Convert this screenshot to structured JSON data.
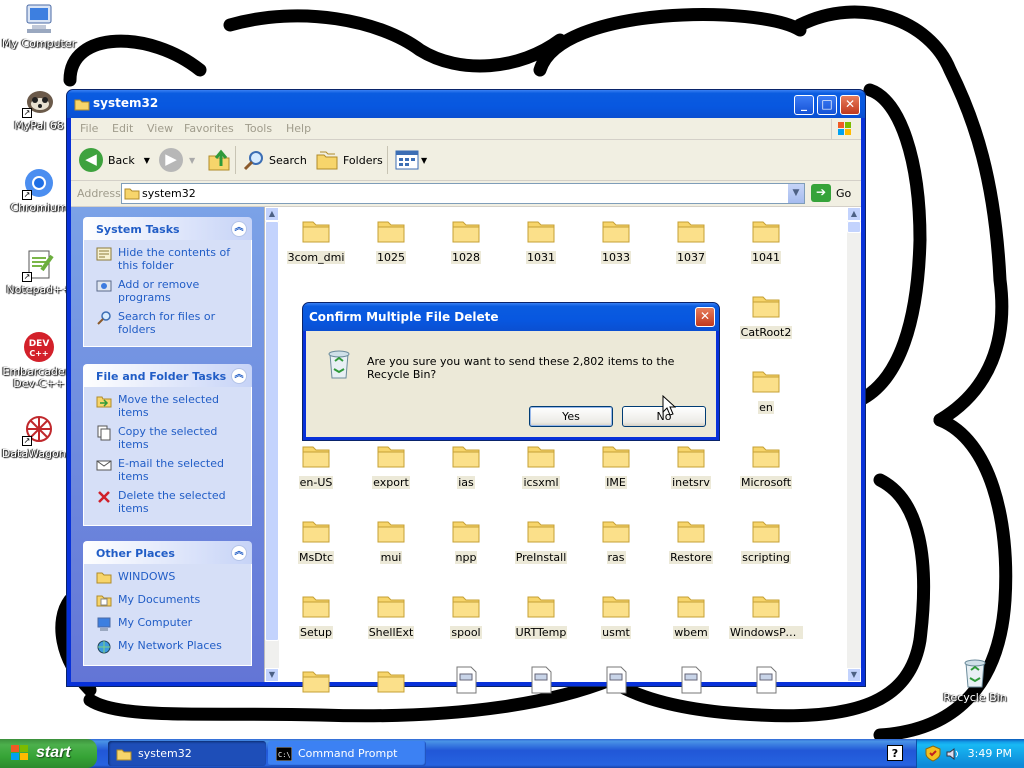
{
  "desktop": {
    "icons": [
      {
        "label": "My Computer"
      },
      {
        "label": "MyPal 68"
      },
      {
        "label": "Chromium"
      },
      {
        "label": "Notepad++"
      },
      {
        "label": "Embarcadero Dev-C++"
      },
      {
        "label": "DataWagon..."
      },
      {
        "label": "Recycle Bin"
      }
    ]
  },
  "window": {
    "title": "system32",
    "menu": [
      "File",
      "Edit",
      "View",
      "Favorites",
      "Tools",
      "Help"
    ],
    "toolbar": {
      "back": "Back",
      "search": "Search",
      "folders": "Folders"
    },
    "address": {
      "label": "Address",
      "value": "system32",
      "go": "Go"
    },
    "task_panels": [
      {
        "title": "System Tasks",
        "items": [
          {
            "label": "Hide the contents of this folder",
            "icon": "hide-contents-icon"
          },
          {
            "label": "Add or remove programs",
            "icon": "add-remove-programs-icon"
          },
          {
            "label": "Search for files or folders",
            "icon": "search-icon"
          }
        ]
      },
      {
        "title": "File and Folder Tasks",
        "items": [
          {
            "label": "Move the selected items",
            "icon": "move-icon"
          },
          {
            "label": "Copy the selected items",
            "icon": "copy-icon"
          },
          {
            "label": "E-mail the selected items",
            "icon": "email-icon"
          },
          {
            "label": "Delete the selected items",
            "icon": "delete-icon"
          }
        ]
      },
      {
        "title": "Other Places",
        "items": [
          {
            "label": "WINDOWS",
            "icon": "folder-icon"
          },
          {
            "label": "My Documents",
            "icon": "my-documents-icon"
          },
          {
            "label": "My Computer",
            "icon": "my-computer-icon"
          },
          {
            "label": "My Network Places",
            "icon": "network-places-icon"
          }
        ]
      }
    ],
    "files": [
      [
        "3com_dmi",
        "1025",
        "1028",
        "1031",
        "1033",
        "1037",
        "1041"
      ],
      [
        "",
        "",
        "",
        "",
        "",
        "",
        "CatRoot2"
      ],
      [
        "",
        "",
        "",
        "",
        "",
        "",
        "en"
      ],
      [
        "en-US",
        "export",
        "ias",
        "icsxml",
        "IME",
        "inetsrv",
        "Microsoft"
      ],
      [
        "MsDtc",
        "mui",
        "npp",
        "PreInstall",
        "ras",
        "Restore",
        "scripting"
      ],
      [
        "Setup",
        "ShellExt",
        "spool",
        "URTTemp",
        "usmt",
        "wbem",
        "WindowsPo..."
      ]
    ]
  },
  "dialog": {
    "title": "Confirm Multiple File Delete",
    "message": "Are you sure you want to send these 2,802 items to the Recycle Bin?",
    "yes": "Yes",
    "no": "No"
  },
  "taskbar": {
    "start": "start",
    "buttons": [
      "system32",
      "Command Prompt"
    ],
    "clock": "3:49 PM",
    "help": "?"
  }
}
